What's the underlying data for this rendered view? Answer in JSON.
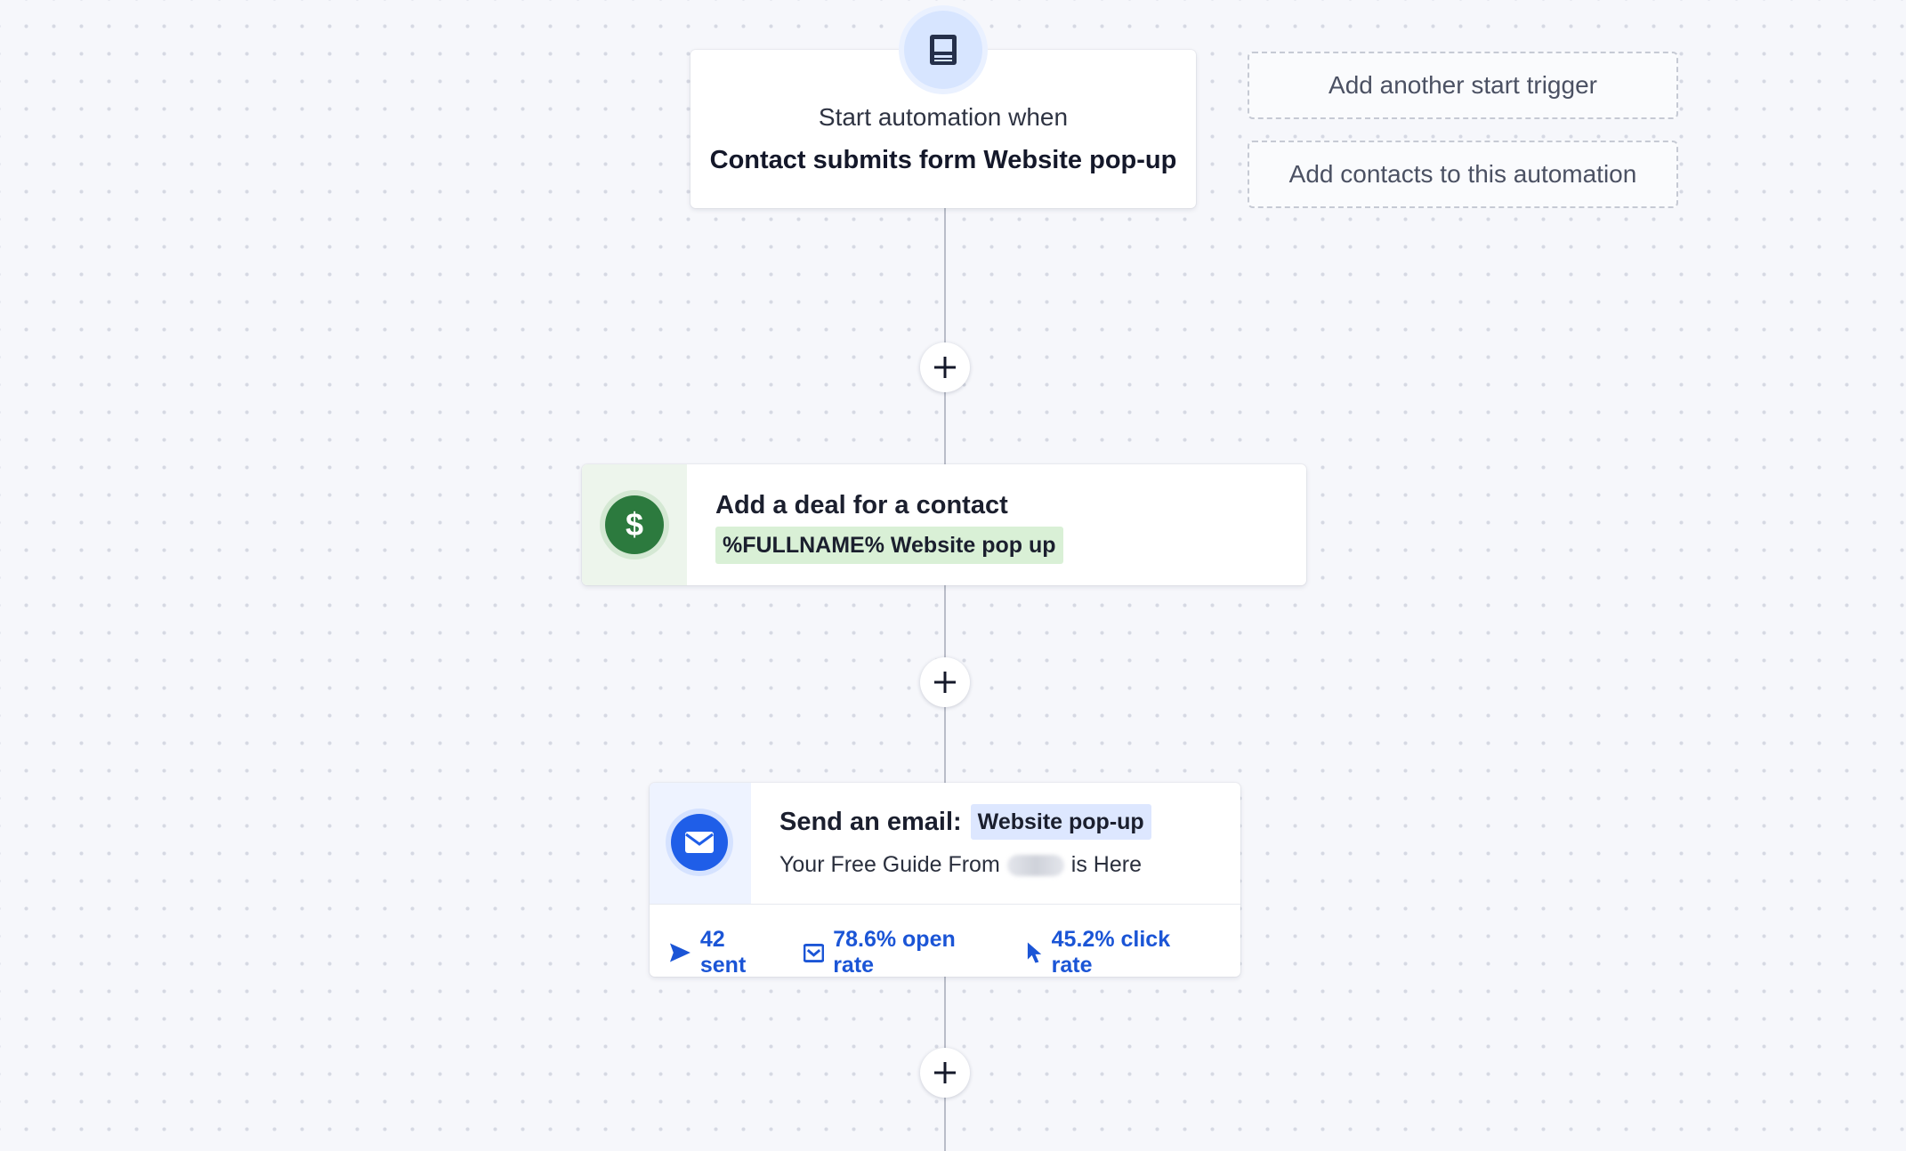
{
  "trigger": {
    "line1": "Start automation when",
    "line2": "Contact submits form Website pop-up",
    "icon": "form-icon"
  },
  "side_actions": {
    "add_trigger": "Add another start trigger",
    "add_contacts": "Add contacts to this automation"
  },
  "steps": [
    {
      "type": "deal",
      "icon": "dollar-icon",
      "icon_glyph": "$",
      "title": "Add a deal for a contact",
      "tag": "%FULLNAME% Website pop up",
      "color": "#2c7a3e"
    },
    {
      "type": "email",
      "icon": "envelope-icon",
      "title": "Send an email:",
      "tag": "Website pop-up",
      "subject_before": "Your Free Guide From",
      "subject_after": "is Here",
      "color": "#1f5ee8",
      "stats": {
        "sent": "42 sent",
        "open_rate": "78.6% open rate",
        "click_rate": "45.2% click rate"
      }
    }
  ],
  "add_step_icon": "plus-icon"
}
